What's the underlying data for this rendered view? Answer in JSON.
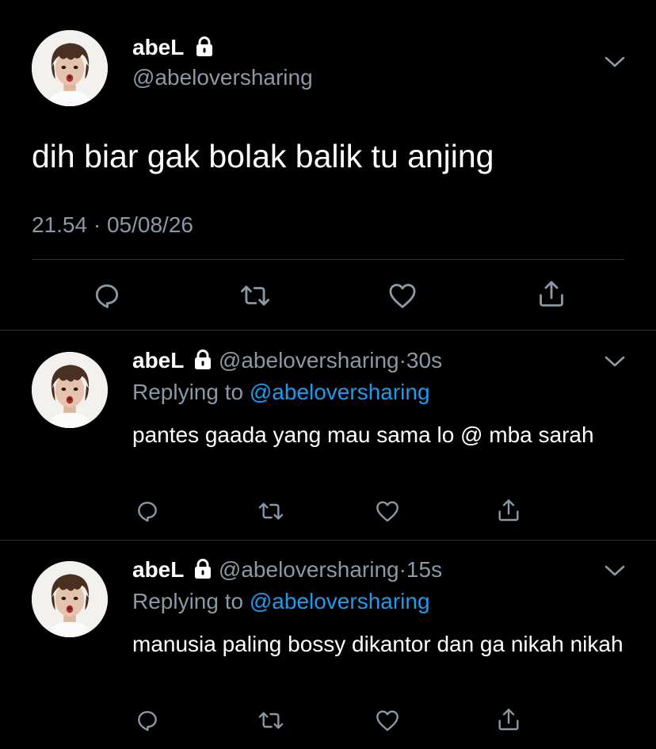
{
  "main_tweet": {
    "name": "abeL",
    "handle": "@abeloversharing",
    "text": "dih biar gak bolak balik tu anjing",
    "time": "21.54",
    "separator": "·",
    "date": "05/08/26"
  },
  "replies": [
    {
      "name": "abeL",
      "handle": "@abeloversharing",
      "dot": "·",
      "time": "30s",
      "replying_label": "Replying to",
      "replying_to": "@abeloversharing",
      "text": "pantes gaada yang mau sama lo @ mba sarah"
    },
    {
      "name": "abeL",
      "handle": "@abeloversharing",
      "dot": "·",
      "time": "15s",
      "replying_label": "Replying to",
      "replying_to": "@abeloversharing",
      "text": "manusia paling bossy dikantor dan ga nikah nikah"
    }
  ],
  "icons": {
    "lock": "lock-icon",
    "menu": "chevron-down-icon",
    "reply": "reply-icon",
    "retweet": "retweet-icon",
    "like": "heart-icon",
    "share": "share-icon"
  },
  "colors": {
    "background": "#000000",
    "text": "#ffffff",
    "muted": "#8b98a5",
    "link": "#1d9bf0",
    "divider": "#2f3336"
  }
}
